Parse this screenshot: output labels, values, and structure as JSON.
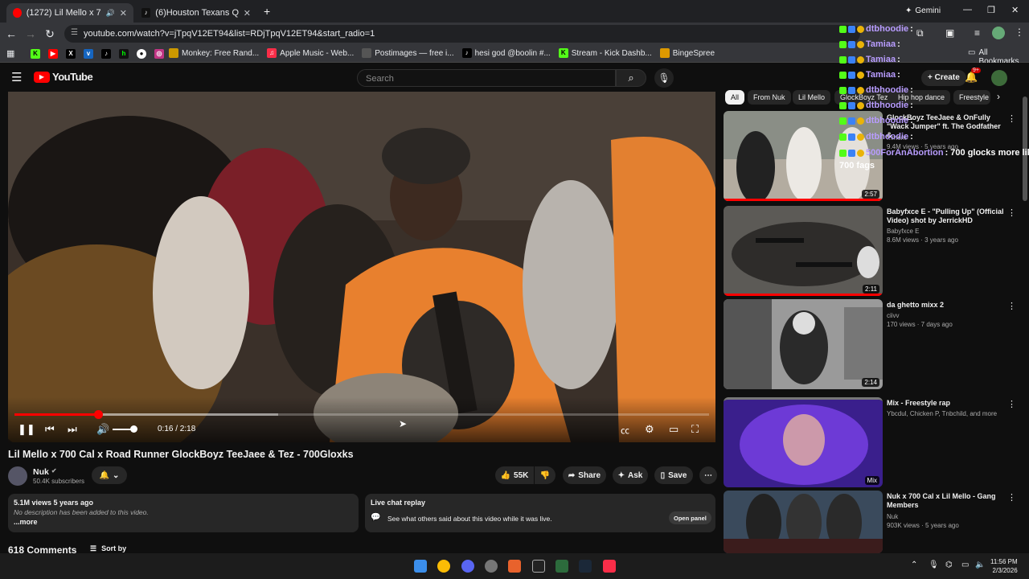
{
  "browser": {
    "tabs": [
      {
        "title": "(1272) Lil Mello x 700 Cal x",
        "active": true
      },
      {
        "title": "(6)Houston Texans QB C.J. Stro",
        "active": false
      }
    ],
    "profile_label": "Gemini",
    "url": "youtube.com/watch?v=jTpqV12ET94&list=RDjTpqV12ET94&start_radio=1",
    "bookmarks": [
      "Monkey: Free Rand...",
      "Apple Music - Web...",
      "Postimages — free i...",
      "hesi god @boolin #...",
      "Stream - Kick Dashb...",
      "BingeSpree"
    ],
    "all_bookmarks": "All Bookmarks"
  },
  "youtube": {
    "logo": "YouTube",
    "search_placeholder": "Search",
    "create_label": "Create",
    "notif_count": "9+"
  },
  "player": {
    "time": "0:16 / 2:18",
    "progress": 0.12,
    "buffered": 0.38
  },
  "video": {
    "title": "Lil Mello x 700 Cal x Road Runner GlockBoyz TeeJaee & Tez - 700Gloxks",
    "channel": "Nuk",
    "subscribers": "50.4K subscribers",
    "likes": "55K",
    "share": "Share",
    "ask": "Ask",
    "save": "Save",
    "views_date": "5.1M views  5 years ago",
    "description": "No description has been added to this video.",
    "more": "...more",
    "live_chat_title": "Live chat replay",
    "live_chat_text": "See what others said about this video while it was live.",
    "open_panel": "Open panel",
    "comments_count": "618 Comments",
    "sort_by": "Sort by"
  },
  "chips": [
    "All",
    "From Nuk",
    "Lil Mello",
    "GlockBoyz Tez",
    "Hip hop dance",
    "Freestyle"
  ],
  "related": [
    {
      "title": "GlockBoyz TeeJaee & OnFully \"Wack Jumper\" ft. The Godfather & ...",
      "channel": "...ment",
      "meta": "9.4M views · 5 years ago",
      "duration": "2:57"
    },
    {
      "title": "Babyfxce E - \"Pulling Up\" (Official Video) shot by JerrickHD",
      "channel": "Babyfxce E",
      "meta": "8.6M views · 3 years ago",
      "duration": "2:11"
    },
    {
      "title": "da ghetto mixx 2",
      "channel": "ciivv",
      "meta": "170 views · 7 days ago",
      "duration": "2:14"
    },
    {
      "title": "Mix - Freestyle rap",
      "channel": "Ybcdul, Chicken P, Tnbchild, and more",
      "meta": "",
      "duration": "Mix"
    },
    {
      "title": "Nuk x 700 Cal x Lil Mello - Gang Members",
      "channel": "Nuk",
      "meta": "903K views · 5 years ago",
      "duration": ""
    }
  ],
  "chat_overlay": [
    {
      "user": "dtbhoodie",
      "msg": ":"
    },
    {
      "user": "Tamiaa",
      "msg": ":"
    },
    {
      "user": "Tamiaa",
      "msg": ":"
    },
    {
      "user": "Tamiaa",
      "msg": ":"
    },
    {
      "user": "dtbhoodie",
      "msg": ":"
    },
    {
      "user": "dtbhoodie",
      "msg": ":"
    },
    {
      "user": "dtbhoodie",
      "msg": ":"
    },
    {
      "user": "dtbhoodie",
      "msg": ":"
    },
    {
      "user": "500ForAnAbortion",
      "msg": ": 700 glocks more like"
    },
    {
      "user": "",
      "msg": "700 fags"
    }
  ],
  "system": {
    "time": "11:56 PM",
    "date": "2/3/2026"
  },
  "colors": {
    "accent_red": "#ff0000",
    "chat_name": "#b89cff",
    "bg": "#0f0f0f"
  }
}
